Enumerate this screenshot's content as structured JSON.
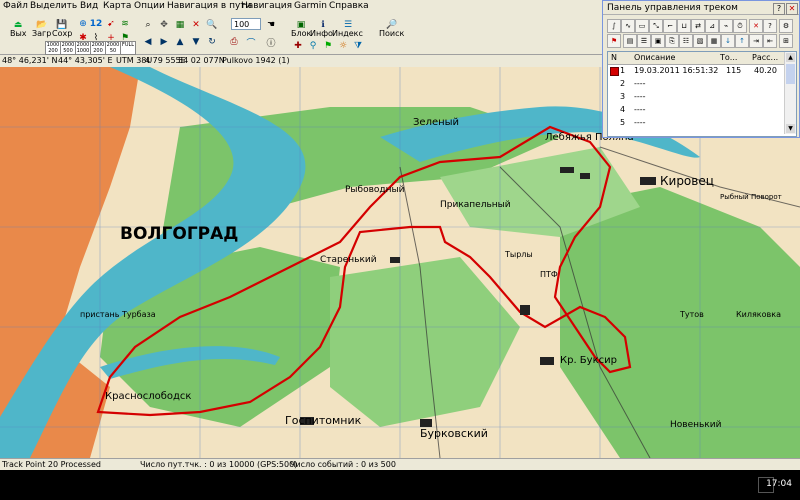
{
  "menubar": {
    "items": [
      "Файл",
      "Выделить",
      "Вид",
      "Карта",
      "Опции",
      "Навигация в пути",
      "Навигация",
      "Garmin",
      "Справка"
    ]
  },
  "toolbar": {
    "labels": [
      "Вых",
      "Загр",
      "Сохр",
      "Блок",
      "Инфо",
      "Индекс",
      "Поиск"
    ],
    "small_buttons": [
      "1000 200",
      "2000 500",
      "2000 1000",
      "2000 200",
      "2000 50",
      "FULL"
    ],
    "zoom_value": "100"
  },
  "coordbar": {
    "lat": "48° 46,231' N",
    "lon": "44° 43,305' E",
    "utm": "UTM 38U",
    "easting": "4 79 555E",
    "northing": "54 02 077N",
    "datum": "Pulkovo 1942 (1)"
  },
  "panel": {
    "title": "Панель управления треком",
    "columns": [
      "N",
      "Описание",
      "То...",
      "Расс..."
    ],
    "rows": [
      {
        "n": "1",
        "desc": "19.03.2011 16:51:32",
        "points": "115",
        "dist": "40.20"
      },
      {
        "n": "2",
        "desc": "----",
        "points": "",
        "dist": ""
      },
      {
        "n": "3",
        "desc": "----",
        "points": "",
        "dist": ""
      },
      {
        "n": "4",
        "desc": "----",
        "points": "",
        "dist": ""
      },
      {
        "n": "5",
        "desc": "----",
        "points": "",
        "dist": ""
      }
    ]
  },
  "map": {
    "city_label": "ВОЛГОГРАД",
    "labels": [
      "Зеленый",
      "Лебяжья Поляна",
      "Кировец",
      "Рыбоводный",
      "Прикапельный",
      "Старенький",
      "Госпитомник",
      "Бурковский",
      "Кр. Буксир",
      "Краснослободск",
      "Тутов",
      "Киляковка",
      "Новенький",
      "пристань Турбаза",
      "Тырлы",
      "ПТФ",
      "Рыбный Поворот"
    ]
  },
  "status": {
    "processed": "Track Point 20 Processed",
    "points": "Число пут.тчк. : 0 из 10000  (GPS:500)",
    "events": "Число событий : 0 из 500"
  },
  "taskbar": {
    "clock": "17:04"
  },
  "colors": {
    "track": "#d40000",
    "water": "#4fb6c9",
    "forest": "#6cbf5c",
    "urban": "#e07b3a"
  }
}
